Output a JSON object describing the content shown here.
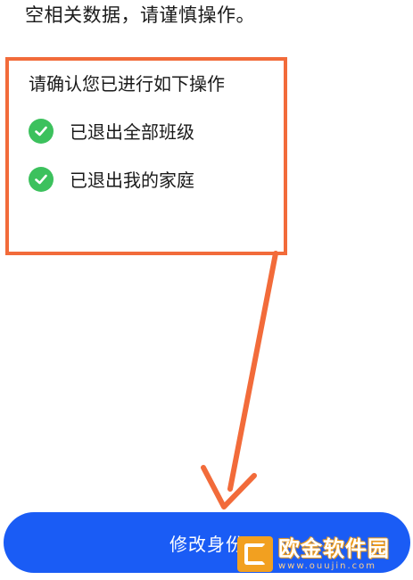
{
  "header": {
    "text": "空相关数据，请谨慎操作。"
  },
  "confirm": {
    "title": "请确认您已进行如下操作",
    "items": [
      {
        "label": "已退出全部班级"
      },
      {
        "label": "已退出我的家庭"
      }
    ]
  },
  "button": {
    "label": "修改身份"
  },
  "watermark": {
    "title": "欧金软件园",
    "subtitle": "www.ouujin.com"
  },
  "colors": {
    "annotation": "#f26b3a",
    "primary": "#1a5cf5",
    "check": "#3cc15d"
  }
}
